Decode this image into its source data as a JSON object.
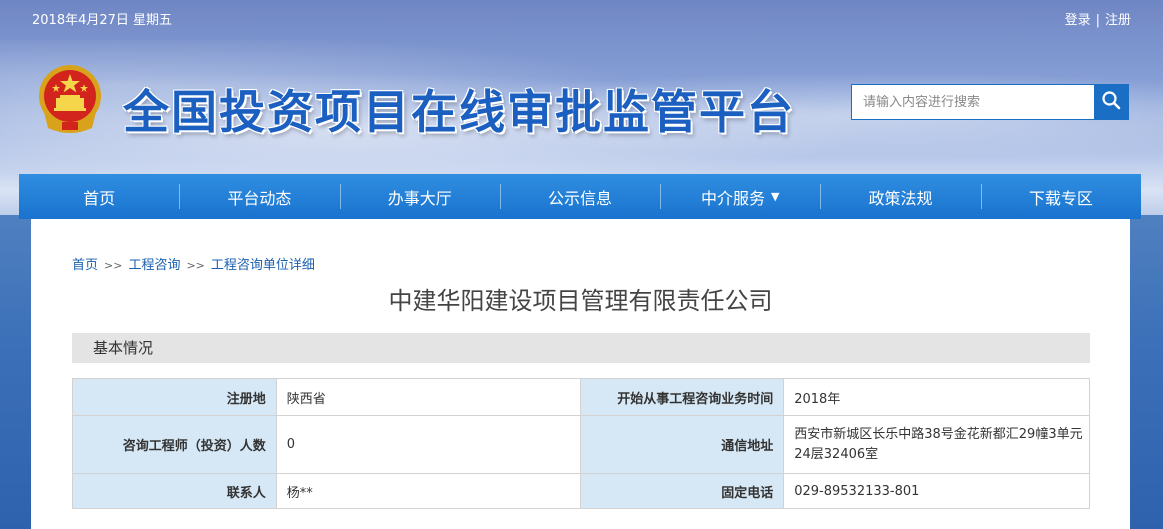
{
  "topbar": {
    "date": "2018年4月27日 星期五",
    "login": "登录",
    "separator": "|",
    "register": "注册"
  },
  "header": {
    "site_title": "全国投资项目在线审批监管平台",
    "emblem_icon": "national-emblem-icon"
  },
  "search": {
    "placeholder": "请输入内容进行搜索",
    "button_icon": "search-icon"
  },
  "nav": {
    "items": [
      {
        "label": "首页"
      },
      {
        "label": "平台动态"
      },
      {
        "label": "办事大厅"
      },
      {
        "label": "公示信息"
      },
      {
        "label": "中介服务",
        "caret": "▼"
      },
      {
        "label": "政策法规"
      },
      {
        "label": "下载专区"
      }
    ]
  },
  "breadcrumb": {
    "items": [
      "首页",
      "工程咨询",
      "工程咨询单位详细"
    ],
    "separator": ">>"
  },
  "company": {
    "name": "中建华阳建设项目管理有限责任公司"
  },
  "section": {
    "title": "基本情况"
  },
  "info_table": {
    "rows": [
      {
        "label1": "注册地",
        "value1": "陕西省",
        "label2": "开始从事工程咨询业务时间",
        "value2": "2018年"
      },
      {
        "label1": "咨询工程师（投资）人数",
        "value1": "0",
        "label2": "通信地址",
        "value2": "西安市新城区长乐中路38号金花新都汇29幢3单元24层32406室"
      },
      {
        "label1": "联系人",
        "value1": "杨**",
        "label2": "固定电话",
        "value2": "029-89532133-801"
      }
    ]
  },
  "colors": {
    "nav_bg": "#1a73cf",
    "title_blue": "#1b5fc0",
    "label_bg": "#d6e8f6",
    "section_bg": "#e4e4e4"
  }
}
